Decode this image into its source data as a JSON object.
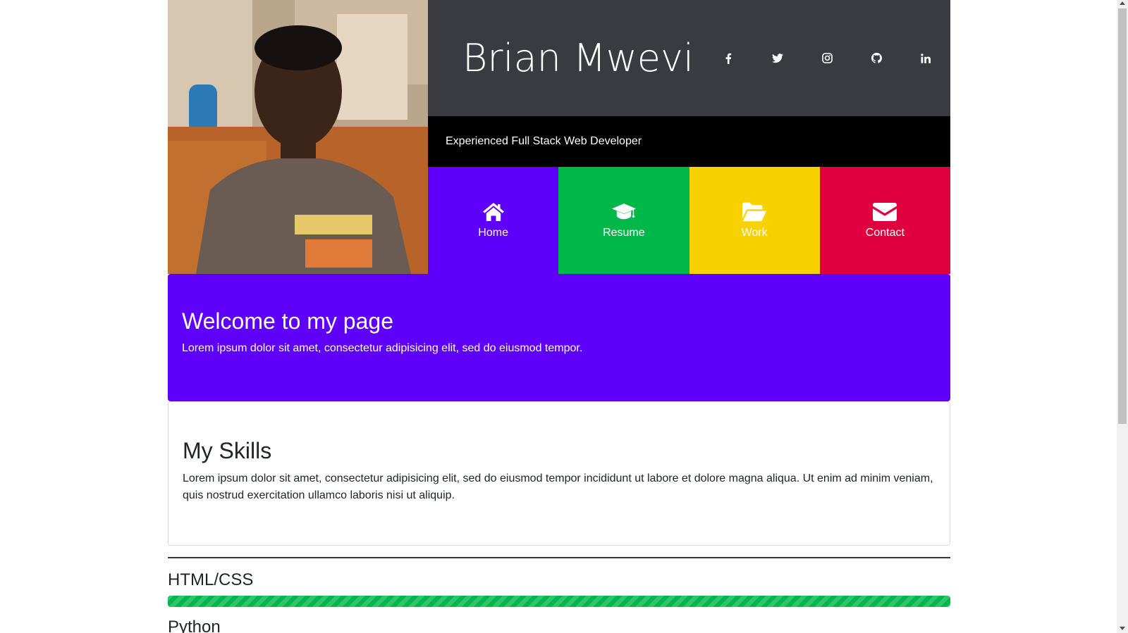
{
  "header": {
    "name": "Brian Mwevi",
    "tagline": "Experienced Full Stack Web Developer",
    "photo_alt": "profile-photo",
    "socials": [
      {
        "icon": "facebook-icon"
      },
      {
        "icon": "twitter-icon"
      },
      {
        "icon": "instagram-icon"
      },
      {
        "icon": "github-icon"
      },
      {
        "icon": "linkedin-icon"
      }
    ]
  },
  "nav": {
    "items": [
      {
        "label": "Home",
        "icon": "home-icon",
        "color": "#5f00fa"
      },
      {
        "label": "Resume",
        "icon": "graduation-cap-icon",
        "color": "#00b84a"
      },
      {
        "label": "Work",
        "icon": "folder-open-icon",
        "color": "#f7d100"
      },
      {
        "label": "Contact",
        "icon": "envelope-icon",
        "color": "#e00040"
      }
    ]
  },
  "welcome": {
    "title": "Welcome to my page",
    "text": "Lorem ipsum dolor sit amet, consectetur adipisicing elit, sed do eiusmod tempor."
  },
  "skills": {
    "title": "My Skills",
    "text": "Lorem ipsum dolor sit amet, consectetur adipisicing elit, sed do eiusmod tempor incididunt ut labore et dolore magna aliqua. Ut enim ad minim veniam, quis nostrud exercitation ullamco laboris nisi ut aliquip.",
    "items": [
      {
        "name": "HTML/CSS",
        "level_percent": 100
      },
      {
        "name": "Python"
      }
    ]
  }
}
